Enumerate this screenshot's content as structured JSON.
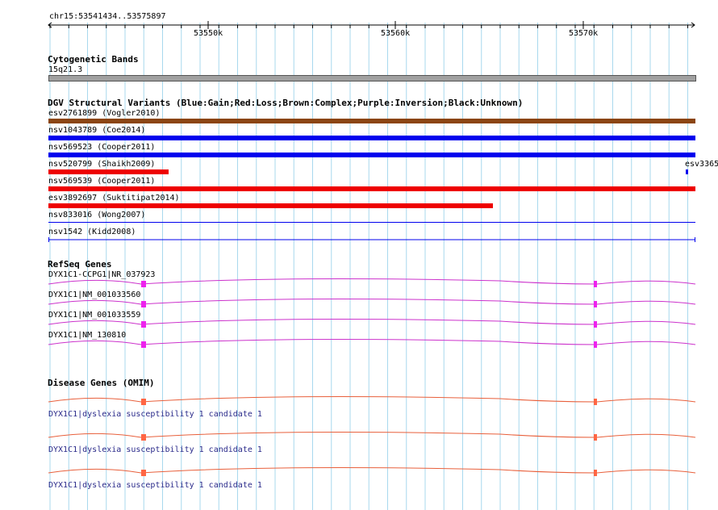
{
  "ruler": {
    "location": "chr15:53541434..53575897",
    "ticks": [
      "53550k",
      "53560k",
      "53570k"
    ]
  },
  "cytoband": {
    "title": "Cytogenetic Bands",
    "band_label": "15q21.3",
    "band_color": "#a0a0a0"
  },
  "dgv": {
    "title": "DGV Structural Variants (Blue:Gain;Red:Loss;Brown:Complex;Purple:Inversion;Black:Unknown)",
    "colors": {
      "gain": "#0000ee",
      "loss": "#ee0000",
      "complex": "#8b4513",
      "unknown": "#000000"
    },
    "variants": [
      {
        "label": "esv2761899 (Vogler2010)",
        "type": "complex"
      },
      {
        "label": "nsv1043789 (Coe2014)",
        "type": "gain"
      },
      {
        "label": "nsv569523 (Cooper2011)",
        "type": "gain"
      },
      {
        "label": "nsv520799 (Shaikh2009)",
        "type": "loss"
      },
      {
        "label": "esv3365",
        "type": "gain"
      },
      {
        "label": "nsv569539 (Cooper2011)",
        "type": "loss"
      },
      {
        "label": "esv3892697 (Suktitipat2014)",
        "type": "loss"
      },
      {
        "label": "nsv833016 (Wong2007)",
        "type": "gain"
      },
      {
        "label": "nsv1542 (Kidd2008)",
        "type": "gain"
      }
    ]
  },
  "refseq": {
    "title": "RefSeq Genes",
    "color": "#cc33cc",
    "exon_color": "#ee22ee",
    "genes": [
      {
        "label": "DYX1C1-CCPG1|NR_037923"
      },
      {
        "label": "DYX1C1|NM_001033560"
      },
      {
        "label": "DYX1C1|NM_001033559"
      },
      {
        "label": "DYX1C1|NM_130810"
      }
    ]
  },
  "omim": {
    "title": "Disease Genes (OMIM)",
    "color": "#e8603c",
    "genes": [
      {
        "label": "DYX1C1|dyslexia susceptibility 1 candidate 1"
      },
      {
        "label": "DYX1C1|dyslexia susceptibility 1 candidate 1"
      },
      {
        "label": "DYX1C1|dyslexia susceptibility 1 candidate 1"
      }
    ]
  },
  "grid_color": "#a8d8ee"
}
